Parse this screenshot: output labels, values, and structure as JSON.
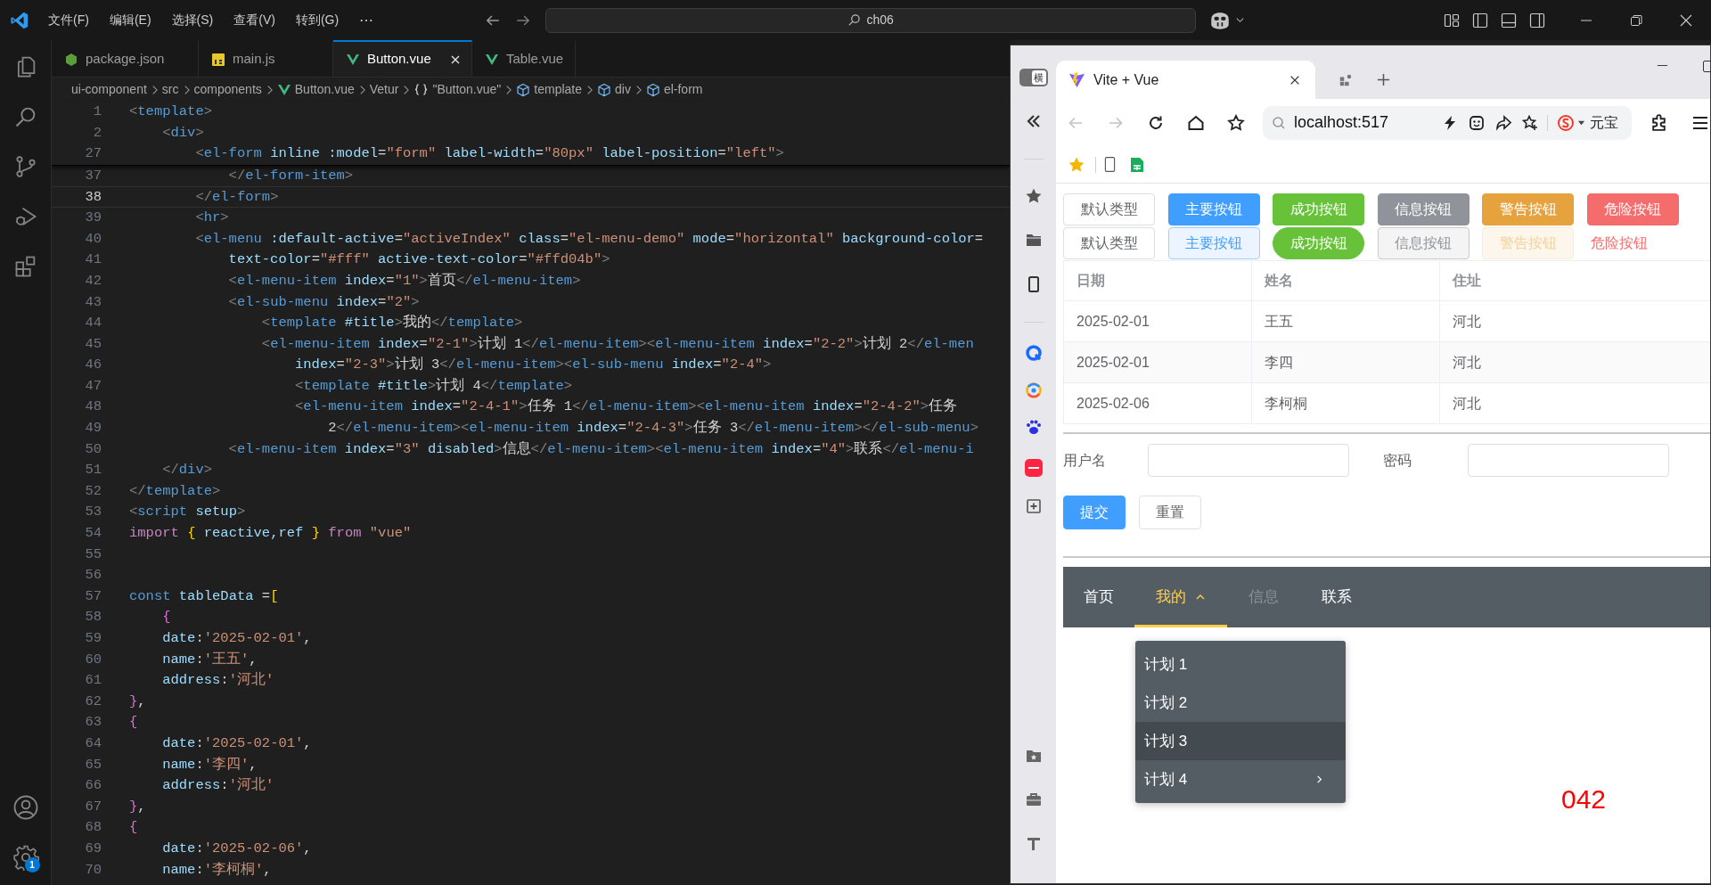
{
  "titlebar": {
    "menus": [
      "文件(F)",
      "编辑(E)",
      "选择(S)",
      "查看(V)",
      "转到(G)"
    ],
    "more": "⋯",
    "search": "ch06"
  },
  "activity_badge": "1",
  "editor_tabs": [
    {
      "label": "package.json",
      "kind": "json",
      "selected": false
    },
    {
      "label": "main.js",
      "kind": "js",
      "selected": false
    },
    {
      "label": "Button.vue",
      "kind": "vue",
      "selected": true
    },
    {
      "label": "Table.vue",
      "kind": "vue",
      "selected": false
    }
  ],
  "breadcrumb": [
    {
      "label": "ui-component",
      "kind": "text"
    },
    {
      "label": "src",
      "kind": "text"
    },
    {
      "label": "components",
      "kind": "text"
    },
    {
      "label": "Button.vue",
      "kind": "vue"
    },
    {
      "label": "Vetur",
      "kind": "text"
    },
    {
      "label": "\"Button.vue\"",
      "kind": "braces"
    },
    {
      "label": "template",
      "kind": "element"
    },
    {
      "label": "div",
      "kind": "element"
    },
    {
      "label": "el-form",
      "kind": "element"
    }
  ],
  "code": {
    "sticky": [
      {
        "number": "1",
        "tokens": [
          {
            "kind": "p",
            "text": "<"
          },
          {
            "kind": "tag",
            "text": "template"
          },
          {
            "kind": "p",
            "text": ">"
          }
        ]
      },
      {
        "number": "2",
        "tokens": [
          {
            "kind": "p",
            "text": "    <"
          },
          {
            "kind": "tag",
            "text": "div"
          },
          {
            "kind": "p",
            "text": ">"
          }
        ]
      },
      {
        "number": "27",
        "tokens": [
          {
            "kind": "p",
            "text": "        <"
          },
          {
            "kind": "tag",
            "text": "el-form"
          },
          {
            "kind": "attr",
            "text": " inline :model"
          },
          {
            "kind": "op",
            "text": "="
          },
          {
            "kind": "str",
            "text": "\"form\""
          },
          {
            "kind": "attr",
            "text": " label-width"
          },
          {
            "kind": "op",
            "text": "="
          },
          {
            "kind": "str",
            "text": "\"80px\""
          },
          {
            "kind": "attr",
            "text": " label-position"
          },
          {
            "kind": "op",
            "text": "="
          },
          {
            "kind": "str",
            "text": "\"left\""
          },
          {
            "kind": "p",
            "text": ">"
          }
        ]
      }
    ],
    "lines": [
      {
        "number": "37",
        "active": false,
        "tokens": [
          {
            "kind": "p",
            "text": "            </"
          },
          {
            "kind": "tag",
            "text": "el-form-item"
          },
          {
            "kind": "p",
            "text": ">"
          }
        ]
      },
      {
        "number": "38",
        "active": true,
        "tokens": [
          {
            "kind": "p",
            "text": "        </"
          },
          {
            "kind": "tag",
            "text": "el-form"
          },
          {
            "kind": "p",
            "text": ">"
          }
        ]
      },
      {
        "number": "39",
        "active": false,
        "tokens": [
          {
            "kind": "p",
            "text": "        <"
          },
          {
            "kind": "tag",
            "text": "hr"
          },
          {
            "kind": "p",
            "text": ">"
          }
        ]
      },
      {
        "number": "40",
        "active": false,
        "tokens": [
          {
            "kind": "p",
            "text": "        <"
          },
          {
            "kind": "tag",
            "text": "el-menu"
          },
          {
            "kind": "attr",
            "text": " :default-active"
          },
          {
            "kind": "op",
            "text": "="
          },
          {
            "kind": "str",
            "text": "\"activeIndex\""
          },
          {
            "kind": "attr",
            "text": " class"
          },
          {
            "kind": "op",
            "text": "="
          },
          {
            "kind": "str",
            "text": "\"el-menu-demo\""
          },
          {
            "kind": "attr",
            "text": " mode"
          },
          {
            "kind": "op",
            "text": "="
          },
          {
            "kind": "str",
            "text": "\"horizontal\""
          },
          {
            "kind": "attr",
            "text": " background-color"
          },
          {
            "kind": "op",
            "text": "="
          }
        ]
      },
      {
        "number": "41",
        "active": false,
        "tokens": [
          {
            "kind": "attr",
            "text": "            text-color"
          },
          {
            "kind": "op",
            "text": "="
          },
          {
            "kind": "str",
            "text": "\"#fff\""
          },
          {
            "kind": "attr",
            "text": " active-text-color"
          },
          {
            "kind": "op",
            "text": "="
          },
          {
            "kind": "str",
            "text": "\"#ffd04b\""
          },
          {
            "kind": "p",
            "text": ">"
          }
        ]
      },
      {
        "number": "42",
        "active": false,
        "tokens": [
          {
            "kind": "p",
            "text": "            <"
          },
          {
            "kind": "tag",
            "text": "el-menu-item"
          },
          {
            "kind": "attr",
            "text": " index"
          },
          {
            "kind": "op",
            "text": "="
          },
          {
            "kind": "str",
            "text": "\"1\""
          },
          {
            "kind": "p",
            "text": ">"
          },
          {
            "kind": "txt",
            "text": "首页"
          },
          {
            "kind": "p",
            "text": "</"
          },
          {
            "kind": "tag",
            "text": "el-menu-item"
          },
          {
            "kind": "p",
            "text": ">"
          }
        ]
      },
      {
        "number": "43",
        "active": false,
        "tokens": [
          {
            "kind": "p",
            "text": "            <"
          },
          {
            "kind": "tag",
            "text": "el-sub-menu"
          },
          {
            "kind": "attr",
            "text": " index"
          },
          {
            "kind": "op",
            "text": "="
          },
          {
            "kind": "str",
            "text": "\"2\""
          },
          {
            "kind": "p",
            "text": ">"
          }
        ]
      },
      {
        "number": "44",
        "active": false,
        "tokens": [
          {
            "kind": "p",
            "text": "                <"
          },
          {
            "kind": "tag",
            "text": "template"
          },
          {
            "kind": "attr",
            "text": " #title"
          },
          {
            "kind": "p",
            "text": ">"
          },
          {
            "kind": "txt",
            "text": "我的"
          },
          {
            "kind": "p",
            "text": "</"
          },
          {
            "kind": "tag",
            "text": "template"
          },
          {
            "kind": "p",
            "text": ">"
          }
        ]
      },
      {
        "number": "45",
        "active": false,
        "tokens": [
          {
            "kind": "p",
            "text": "                <"
          },
          {
            "kind": "tag",
            "text": "el-menu-item"
          },
          {
            "kind": "attr",
            "text": " index"
          },
          {
            "kind": "op",
            "text": "="
          },
          {
            "kind": "str",
            "text": "\"2-1\""
          },
          {
            "kind": "p",
            "text": ">"
          },
          {
            "kind": "txt",
            "text": "计划 1"
          },
          {
            "kind": "p",
            "text": "</"
          },
          {
            "kind": "tag",
            "text": "el-menu-item"
          },
          {
            "kind": "p",
            "text": "><"
          },
          {
            "kind": "tag",
            "text": "el-menu-item"
          },
          {
            "kind": "attr",
            "text": " index"
          },
          {
            "kind": "op",
            "text": "="
          },
          {
            "kind": "str",
            "text": "\"2-2\""
          },
          {
            "kind": "p",
            "text": ">"
          },
          {
            "kind": "txt",
            "text": "计划 2"
          },
          {
            "kind": "p",
            "text": "</"
          },
          {
            "kind": "tag",
            "text": "el-men"
          }
        ]
      },
      {
        "number": "46",
        "active": false,
        "tokens": [
          {
            "kind": "attr",
            "text": "                    index"
          },
          {
            "kind": "op",
            "text": "="
          },
          {
            "kind": "str",
            "text": "\"2-3\""
          },
          {
            "kind": "p",
            "text": ">"
          },
          {
            "kind": "txt",
            "text": "计划 3"
          },
          {
            "kind": "p",
            "text": "</"
          },
          {
            "kind": "tag",
            "text": "el-menu-item"
          },
          {
            "kind": "p",
            "text": "><"
          },
          {
            "kind": "tag",
            "text": "el-sub-menu"
          },
          {
            "kind": "attr",
            "text": " index"
          },
          {
            "kind": "op",
            "text": "="
          },
          {
            "kind": "str",
            "text": "\"2-4\""
          },
          {
            "kind": "p",
            "text": ">"
          }
        ]
      },
      {
        "number": "47",
        "active": false,
        "tokens": [
          {
            "kind": "p",
            "text": "                    <"
          },
          {
            "kind": "tag",
            "text": "template"
          },
          {
            "kind": "attr",
            "text": " #title"
          },
          {
            "kind": "p",
            "text": ">"
          },
          {
            "kind": "txt",
            "text": "计划 4"
          },
          {
            "kind": "p",
            "text": "</"
          },
          {
            "kind": "tag",
            "text": "template"
          },
          {
            "kind": "p",
            "text": ">"
          }
        ]
      },
      {
        "number": "48",
        "active": false,
        "tokens": [
          {
            "kind": "p",
            "text": "                    <"
          },
          {
            "kind": "tag",
            "text": "el-menu-item"
          },
          {
            "kind": "attr",
            "text": " index"
          },
          {
            "kind": "op",
            "text": "="
          },
          {
            "kind": "str",
            "text": "\"2-4-1\""
          },
          {
            "kind": "p",
            "text": ">"
          },
          {
            "kind": "txt",
            "text": "任务 1"
          },
          {
            "kind": "p",
            "text": "</"
          },
          {
            "kind": "tag",
            "text": "el-menu-item"
          },
          {
            "kind": "p",
            "text": "><"
          },
          {
            "kind": "tag",
            "text": "el-menu-item"
          },
          {
            "kind": "attr",
            "text": " index"
          },
          {
            "kind": "op",
            "text": "="
          },
          {
            "kind": "str",
            "text": "\"2-4-2\""
          },
          {
            "kind": "p",
            "text": ">"
          },
          {
            "kind": "txt",
            "text": "任务"
          }
        ]
      },
      {
        "number": "49",
        "active": false,
        "tokens": [
          {
            "kind": "txt",
            "text": "                        2"
          },
          {
            "kind": "p",
            "text": "</"
          },
          {
            "kind": "tag",
            "text": "el-menu-item"
          },
          {
            "kind": "p",
            "text": "><"
          },
          {
            "kind": "tag",
            "text": "el-menu-item"
          },
          {
            "kind": "attr",
            "text": " index"
          },
          {
            "kind": "op",
            "text": "="
          },
          {
            "kind": "str",
            "text": "\"2-4-3\""
          },
          {
            "kind": "p",
            "text": ">"
          },
          {
            "kind": "txt",
            "text": "任务 3"
          },
          {
            "kind": "p",
            "text": "</"
          },
          {
            "kind": "tag",
            "text": "el-menu-item"
          },
          {
            "kind": "p",
            "text": "></"
          },
          {
            "kind": "tag",
            "text": "el-sub-menu"
          },
          {
            "kind": "p",
            "text": ">"
          }
        ]
      },
      {
        "number": "50",
        "active": false,
        "tokens": [
          {
            "kind": "p",
            "text": "            <"
          },
          {
            "kind": "tag",
            "text": "el-menu-item"
          },
          {
            "kind": "attr",
            "text": " index"
          },
          {
            "kind": "op",
            "text": "="
          },
          {
            "kind": "str",
            "text": "\"3\""
          },
          {
            "kind": "attr",
            "text": " disabled"
          },
          {
            "kind": "p",
            "text": ">"
          },
          {
            "kind": "txt",
            "text": "信息"
          },
          {
            "kind": "p",
            "text": "</"
          },
          {
            "kind": "tag",
            "text": "el-menu-item"
          },
          {
            "kind": "p",
            "text": "><"
          },
          {
            "kind": "tag",
            "text": "el-menu-item"
          },
          {
            "kind": "attr",
            "text": " index"
          },
          {
            "kind": "op",
            "text": "="
          },
          {
            "kind": "str",
            "text": "\"4\""
          },
          {
            "kind": "p",
            "text": ">"
          },
          {
            "kind": "txt",
            "text": "联系"
          },
          {
            "kind": "p",
            "text": "</"
          },
          {
            "kind": "tag",
            "text": "el-menu-i"
          }
        ]
      },
      {
        "number": "51",
        "active": false,
        "tokens": [
          {
            "kind": "p",
            "text": "    </"
          },
          {
            "kind": "tag",
            "text": "div"
          },
          {
            "kind": "p",
            "text": ">"
          }
        ]
      },
      {
        "number": "52",
        "active": false,
        "tokens": [
          {
            "kind": "p",
            "text": "</"
          },
          {
            "kind": "tag",
            "text": "template"
          },
          {
            "kind": "p",
            "text": ">"
          }
        ]
      },
      {
        "number": "53",
        "active": false,
        "tokens": [
          {
            "kind": "p",
            "text": "<"
          },
          {
            "kind": "tag",
            "text": "script"
          },
          {
            "kind": "attr",
            "text": " setup"
          },
          {
            "kind": "p",
            "text": ">"
          }
        ]
      },
      {
        "number": "54",
        "active": false,
        "tokens": [
          {
            "kind": "kw",
            "text": "import "
          },
          {
            "kind": "b1",
            "text": "{"
          },
          {
            "kind": "var",
            "text": " reactive,ref "
          },
          {
            "kind": "b1",
            "text": "}"
          },
          {
            "kind": "kw",
            "text": " from "
          },
          {
            "kind": "str",
            "text": "\"vue\""
          }
        ]
      },
      {
        "number": "55",
        "active": false
      },
      {
        "number": "56",
        "active": false
      },
      {
        "number": "57",
        "active": false,
        "tokens": [
          {
            "kind": "store",
            "text": "const"
          },
          {
            "kind": "var",
            "text": " tableData "
          },
          {
            "kind": "op",
            "text": "="
          },
          {
            "kind": "b1",
            "text": "["
          }
        ]
      },
      {
        "number": "58",
        "active": false,
        "tokens": [
          {
            "kind": "b2",
            "text": "    {"
          }
        ]
      },
      {
        "number": "59",
        "active": false,
        "tokens": [
          {
            "kind": "prop",
            "text": "    date"
          },
          {
            "kind": "op",
            "text": ":"
          },
          {
            "kind": "str",
            "text": "'2025-02-01'"
          },
          {
            "kind": "op",
            "text": ","
          }
        ]
      },
      {
        "number": "60",
        "active": false,
        "tokens": [
          {
            "kind": "prop",
            "text": "    name"
          },
          {
            "kind": "op",
            "text": ":"
          },
          {
            "kind": "str",
            "text": "'王五'"
          },
          {
            "kind": "op",
            "text": ","
          }
        ]
      },
      {
        "number": "61",
        "active": false,
        "tokens": [
          {
            "kind": "prop",
            "text": "    address"
          },
          {
            "kind": "op",
            "text": ":"
          },
          {
            "kind": "str",
            "text": "'河北'"
          }
        ]
      },
      {
        "number": "62",
        "active": false,
        "tokens": [
          {
            "kind": "b2",
            "text": "}"
          },
          {
            "kind": "op",
            "text": ","
          }
        ]
      },
      {
        "number": "63",
        "active": false,
        "tokens": [
          {
            "kind": "b2",
            "text": "{"
          }
        ]
      },
      {
        "number": "64",
        "active": false,
        "tokens": [
          {
            "kind": "prop",
            "text": "    date"
          },
          {
            "kind": "op",
            "text": ":"
          },
          {
            "kind": "str",
            "text": "'2025-02-01'"
          },
          {
            "kind": "op",
            "text": ","
          }
        ]
      },
      {
        "number": "65",
        "active": false,
        "tokens": [
          {
            "kind": "prop",
            "text": "    name"
          },
          {
            "kind": "op",
            "text": ":"
          },
          {
            "kind": "str",
            "text": "'李四'"
          },
          {
            "kind": "op",
            "text": ","
          }
        ]
      },
      {
        "number": "66",
        "active": false,
        "tokens": [
          {
            "kind": "prop",
            "text": "    address"
          },
          {
            "kind": "op",
            "text": ":"
          },
          {
            "kind": "str",
            "text": "'河北'"
          }
        ]
      },
      {
        "number": "67",
        "active": false,
        "tokens": [
          {
            "kind": "b2",
            "text": "}"
          },
          {
            "kind": "op",
            "text": ","
          }
        ]
      },
      {
        "number": "68",
        "active": false,
        "tokens": [
          {
            "kind": "b2",
            "text": "{"
          }
        ]
      },
      {
        "number": "69",
        "active": false,
        "tokens": [
          {
            "kind": "prop",
            "text": "    date"
          },
          {
            "kind": "op",
            "text": ":"
          },
          {
            "kind": "str",
            "text": "'2025-02-06'"
          },
          {
            "kind": "op",
            "text": ","
          }
        ]
      },
      {
        "number": "70",
        "active": false,
        "tokens": [
          {
            "kind": "prop",
            "text": "    name"
          },
          {
            "kind": "op",
            "text": ":"
          },
          {
            "kind": "str",
            "text": "'李柯桐'"
          },
          {
            "kind": "op",
            "text": ","
          }
        ]
      }
    ]
  },
  "browser": {
    "sidebar_badge": "横",
    "tab_title": "Vite + Vue",
    "address": "localhost:517",
    "toolbar_label": "元宝"
  },
  "page": {
    "button_rows": [
      [
        {
          "label": "默认类型",
          "kind": "default",
          "disabled": false
        },
        {
          "label": "主要按钮",
          "kind": "primary",
          "disabled": false
        },
        {
          "label": "成功按钮",
          "kind": "success",
          "disabled": false
        },
        {
          "label": "信息按钮",
          "kind": "info",
          "disabled": false
        },
        {
          "label": "警告按钮",
          "kind": "warning",
          "disabled": false
        },
        {
          "label": "危险按钮",
          "kind": "danger",
          "disabled": false
        }
      ],
      [
        {
          "label": "默认类型",
          "kind": "default",
          "disabled": false
        },
        {
          "label": "主要按钮",
          "kind": "plain_primary",
          "disabled": false
        },
        {
          "label": "成功按钮",
          "kind": "round_success",
          "disabled": false
        },
        {
          "label": "信息按钮",
          "kind": "plain_info",
          "disabled": false
        },
        {
          "label": "警告按钮",
          "kind": "plain_warning",
          "disabled": true
        },
        {
          "label": "危险按钮",
          "kind": "text_danger",
          "disabled": false
        }
      ]
    ],
    "table": {
      "columns": [
        "日期",
        "姓名",
        "住址"
      ],
      "rows": [
        [
          "2025-02-01",
          "王五",
          "河北"
        ],
        [
          "2025-02-01",
          "李四",
          "河北"
        ],
        [
          "2025-02-06",
          "李柯桐",
          "河北"
        ]
      ]
    },
    "form": {
      "fields": [
        {
          "label": "用户名"
        },
        {
          "label": "密码"
        }
      ],
      "buttons": [
        {
          "label": "提交",
          "kind": "primary"
        },
        {
          "label": "重置",
          "kind": "default"
        }
      ]
    },
    "nav_menu": {
      "items": [
        {
          "label": "首页",
          "kind": "item",
          "selected": false,
          "disabled": false
        },
        {
          "label": "我的",
          "kind": "submenu",
          "selected": true,
          "disabled": false,
          "expanded": true
        },
        {
          "label": "信息",
          "kind": "item",
          "selected": false,
          "disabled": true
        },
        {
          "label": "联系",
          "kind": "item",
          "selected": false,
          "disabled": false
        }
      ],
      "dropdown": [
        {
          "label": "计划 1",
          "kind": "item",
          "highlighted": false
        },
        {
          "label": "计划 2",
          "kind": "item",
          "highlighted": false
        },
        {
          "label": "计划 3",
          "kind": "item",
          "highlighted": true
        },
        {
          "label": "计划 4",
          "kind": "submenu",
          "highlighted": false
        }
      ]
    },
    "corner_text": "042"
  }
}
